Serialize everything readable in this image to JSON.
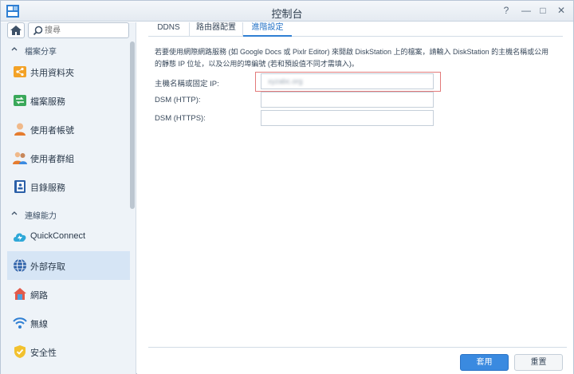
{
  "window": {
    "title": "控制台",
    "controls": [
      "?",
      "—",
      "□",
      "✕"
    ]
  },
  "sidebar": {
    "search_placeholder": "搜尋",
    "sections": [
      {
        "label": "檔案分享"
      },
      {
        "label": "連線能力"
      }
    ],
    "items": [
      {
        "label": "共用資料夾",
        "icon": "shared-folder-icon"
      },
      {
        "label": "檔案服務",
        "icon": "file-services-icon"
      },
      {
        "label": "使用者帳號",
        "icon": "user-icon"
      },
      {
        "label": "使用者群組",
        "icon": "group-icon"
      },
      {
        "label": "目錄服務",
        "icon": "directory-icon"
      },
      {
        "label": "QuickConnect",
        "icon": "quickconnect-icon"
      },
      {
        "label": "外部存取",
        "icon": "external-access-icon",
        "active": true
      },
      {
        "label": "網路",
        "icon": "network-icon"
      },
      {
        "label": "無線",
        "icon": "wifi-icon"
      },
      {
        "label": "安全性",
        "icon": "security-icon"
      }
    ]
  },
  "main": {
    "tabs": [
      {
        "label": "DDNS"
      },
      {
        "label": "路由器配置"
      },
      {
        "label": "進階設定",
        "active": true
      }
    ],
    "description_line1": "若要使用網際網路服務 (如 Google Docs 或 Pixlr Editor) 來開啟 DiskStation 上的檔案，請輸入 DiskStation 的主機名稱或公用",
    "description_line2": "的靜態 IP 位址，以及公用的埠編號 (若和預設值不同才需填入)。",
    "fields": [
      {
        "label": "主機名稱或固定 IP:",
        "value": "xyzabc.org"
      },
      {
        "label": "DSM (HTTP):",
        "value": ""
      },
      {
        "label": "DSM (HTTPS):",
        "value": ""
      }
    ]
  },
  "footer": {
    "apply_label": "套用",
    "reset_label": "重置"
  },
  "colors": {
    "accent": "#3a8ae0",
    "sidebar_bg": "#eef3f8",
    "active_item_bg": "#d6e5f5",
    "highlight_border": "#e27a7a"
  }
}
